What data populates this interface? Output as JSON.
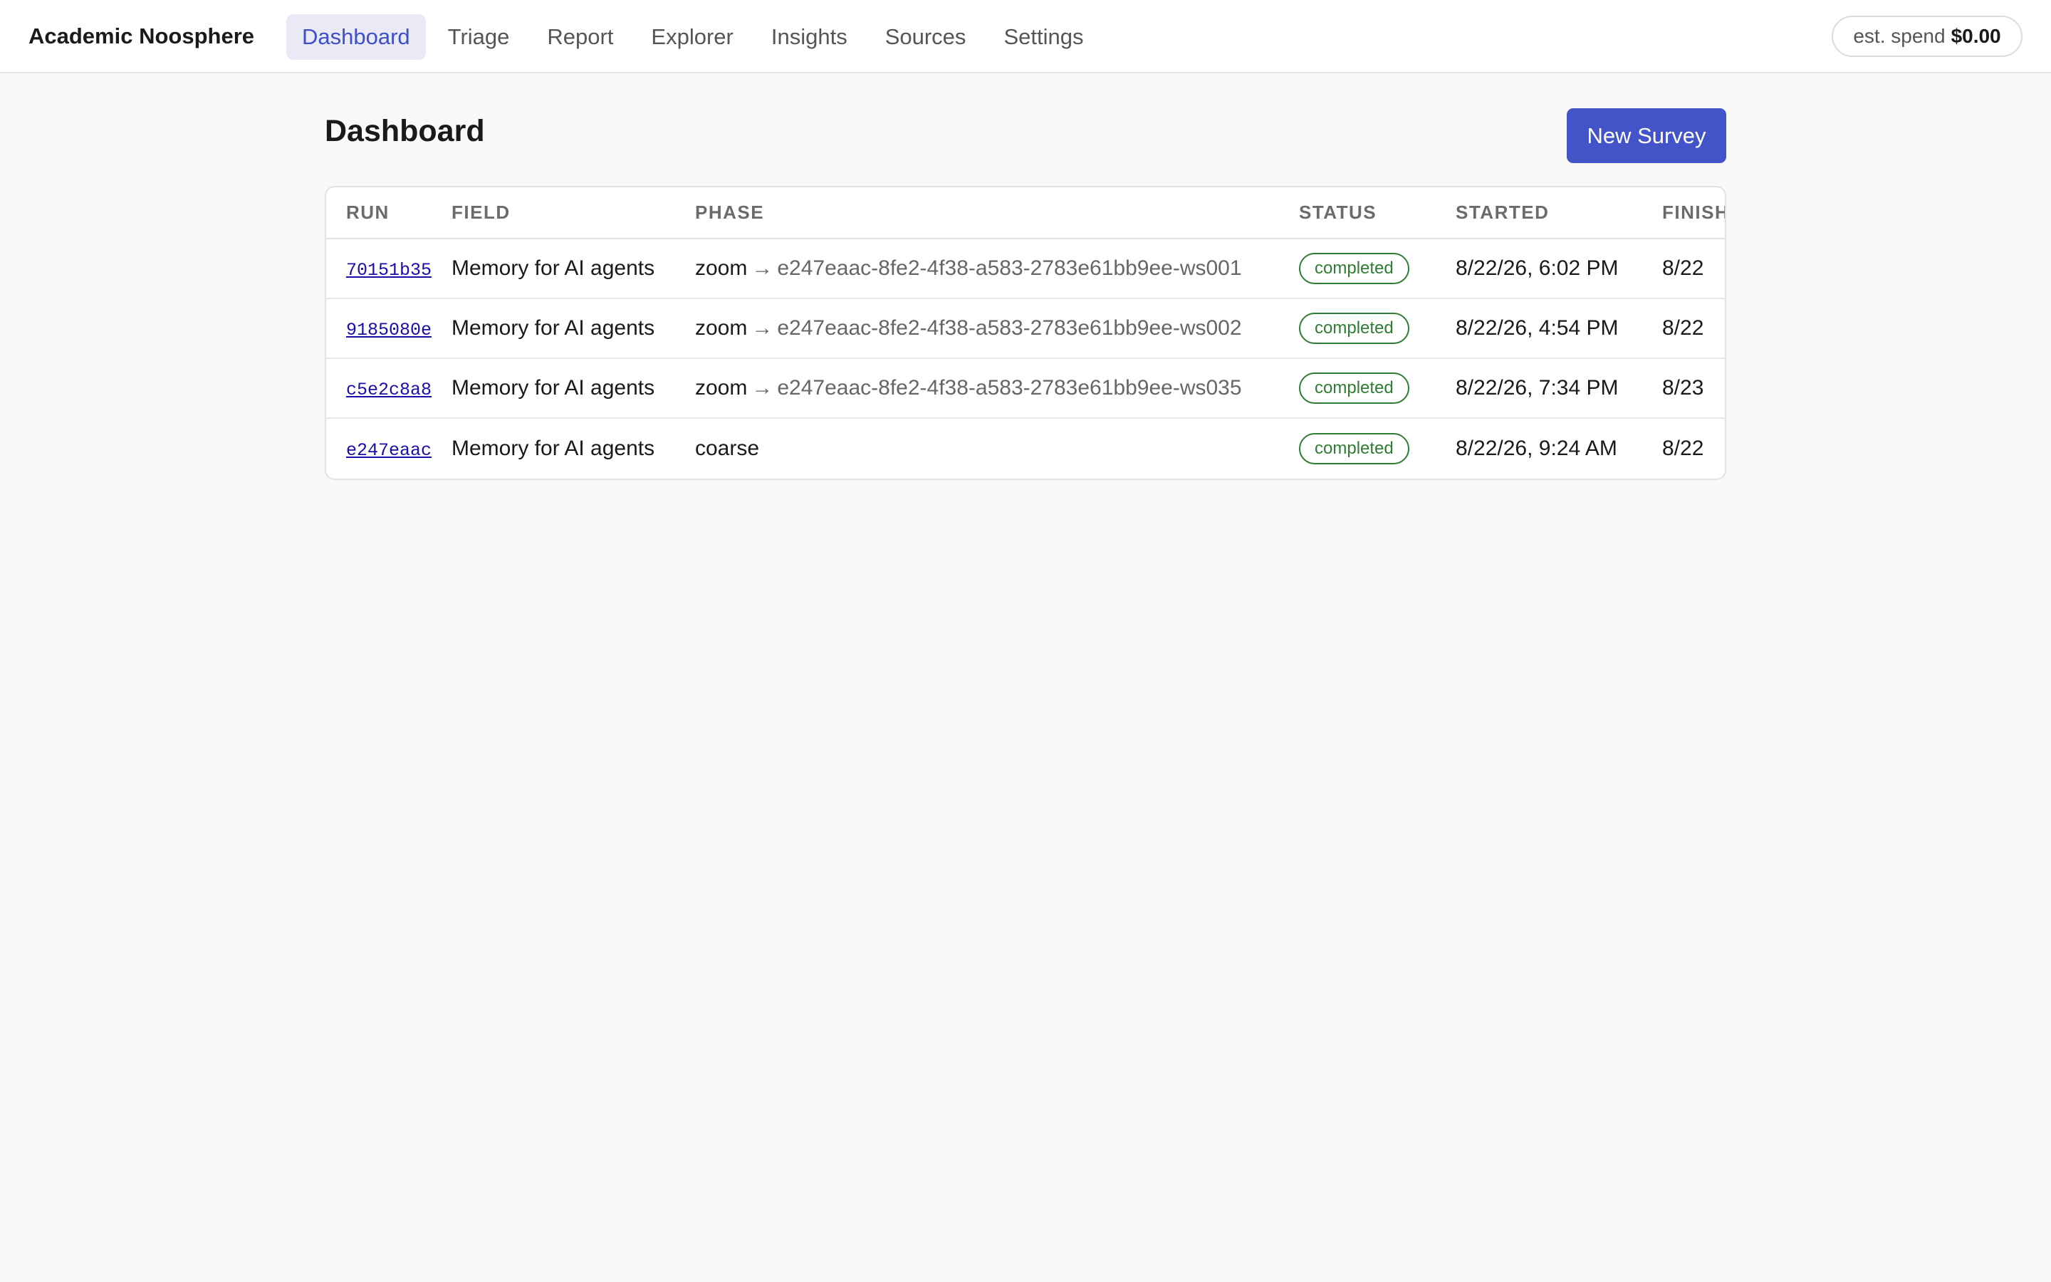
{
  "app": {
    "title": "Academic Noosphere"
  },
  "nav": {
    "items": [
      {
        "label": "Dashboard",
        "active": true
      },
      {
        "label": "Triage"
      },
      {
        "label": "Report"
      },
      {
        "label": "Explorer"
      },
      {
        "label": "Insights"
      },
      {
        "label": "Sources"
      },
      {
        "label": "Settings"
      }
    ]
  },
  "spend": {
    "label": "est. spend",
    "value": "$0.00"
  },
  "page": {
    "title": "Dashboard",
    "new_button": "New Survey"
  },
  "table": {
    "headers": [
      "Run",
      "Field",
      "Phase",
      "Status",
      "Started",
      "Finished"
    ],
    "rows": [
      {
        "run": "70151b35",
        "field": "Memory for AI agents",
        "phase": "zoom",
        "target": "e247eaac-8fe2-4f38-a583-2783e61bb9ee-ws001",
        "status": "completed",
        "started": "8/22/26, 6:02 PM",
        "finished": "8/22"
      },
      {
        "run": "9185080e",
        "field": "Memory for AI agents",
        "phase": "zoom",
        "target": "e247eaac-8fe2-4f38-a583-2783e61bb9ee-ws002",
        "status": "completed",
        "started": "8/22/26, 4:54 PM",
        "finished": "8/22"
      },
      {
        "run": "c5e2c8a8",
        "field": "Memory for AI agents",
        "phase": "zoom",
        "target": "e247eaac-8fe2-4f38-a583-2783e61bb9ee-ws035",
        "status": "completed",
        "started": "8/22/26, 7:34 PM",
        "finished": "8/23"
      },
      {
        "run": "e247eaac",
        "field": "Memory for AI agents",
        "phase": "coarse",
        "target": "",
        "status": "completed",
        "started": "8/22/26, 9:24 AM",
        "finished": "8/22"
      }
    ],
    "arrow_icon": "arrow-right-icon",
    "status_color": "#2e7d32"
  },
  "colors": {
    "accent": "#4353c8",
    "nav_active_bg": "#e9eaf6",
    "nav_active_text": "#3f4fc6",
    "link": "#1a0dab"
  }
}
